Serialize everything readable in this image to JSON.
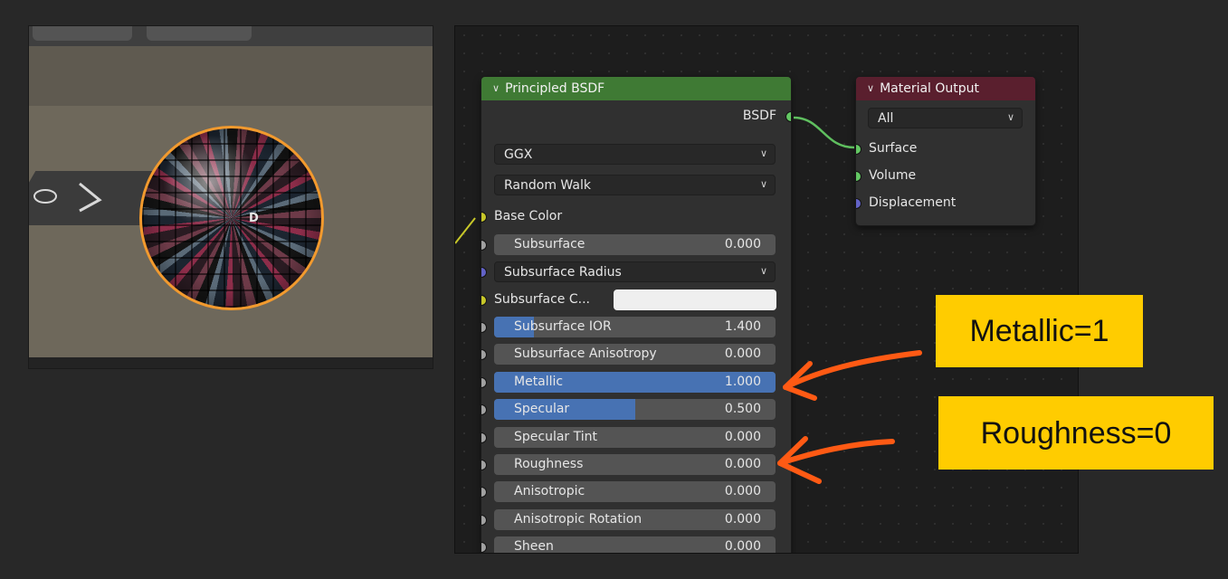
{
  "viewport": {
    "sphere_letters": [
      "D"
    ]
  },
  "principled_node": {
    "title": "Principled BSDF",
    "output_label": "BSDF",
    "dropdowns": [
      {
        "label": "GGX"
      },
      {
        "label": "Random Walk"
      }
    ],
    "base_color_label": "Base Color",
    "subsurface": {
      "label": "Subsurface",
      "value": "0.000",
      "fill": 0
    },
    "subsurface_radius_label": "Subsurface Radius",
    "subsurface_color_label": "Subsurface C...",
    "fields": [
      {
        "label": "Subsurface IOR",
        "value": "1.400",
        "fill": 0.14
      },
      {
        "label": "Subsurface Anisotropy",
        "value": "0.000",
        "fill": 0
      },
      {
        "label": "Metallic",
        "value": "1.000",
        "fill": 1.0
      },
      {
        "label": "Specular",
        "value": "0.500",
        "fill": 0.5
      },
      {
        "label": "Specular Tint",
        "value": "0.000",
        "fill": 0
      },
      {
        "label": "Roughness",
        "value": "0.000",
        "fill": 0
      },
      {
        "label": "Anisotropic",
        "value": "0.000",
        "fill": 0
      },
      {
        "label": "Anisotropic Rotation",
        "value": "0.000",
        "fill": 0
      },
      {
        "label": "Sheen",
        "value": "0.000",
        "fill": 0
      }
    ]
  },
  "material_output_node": {
    "title": "Material Output",
    "target": "All",
    "inputs": [
      "Surface",
      "Volume",
      "Displacement"
    ]
  },
  "annotations": {
    "metallic": "Metallic=1",
    "roughness": "Roughness=0"
  },
  "colors": {
    "principled_header": "#3f7a34",
    "output_header": "#5a1f2e",
    "slider_fill": "#4772b3",
    "annotation_bg": "#ffcc00",
    "arrow": "#ff5a14",
    "selection_outline": "#f29a2e"
  }
}
